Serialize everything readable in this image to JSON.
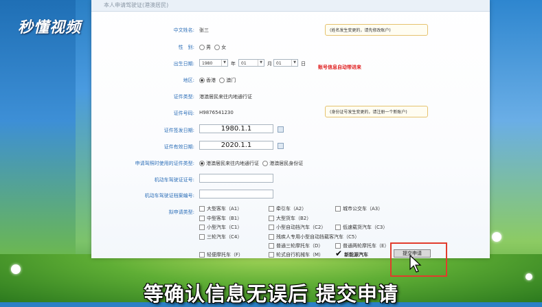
{
  "logo": "秒懂视频",
  "header": "本人申请驾驶证(港澳居民)",
  "form": {
    "name_label": "中文姓名:",
    "name_value": "张三",
    "name_note": "(姓名发生变更的，请先修改账户)",
    "gender_label": "性　别:",
    "gender_options": [
      "男",
      "女"
    ],
    "dob_label": "出生日期:",
    "dob_year": "1980",
    "dob_year_unit": "年",
    "dob_month": "01",
    "dob_month_unit": "月",
    "dob_day": "01",
    "dob_day_unit": "日",
    "auto_note": "账号信息自动带进来",
    "region_label": "地区:",
    "region_options": [
      "香港",
      "澳门"
    ],
    "idtype_label": "证件类型:",
    "idtype_value": "港澳居民来往内地通行证",
    "idnum_label": "证件号码:",
    "idnum_value": "H9876541230",
    "idnum_note": "(身份证号发生变更的，请注册一个新账户)",
    "issue_label": "证件签发日期:",
    "issue_value": "1980.1.1",
    "expiry_label": "证件有效日期:",
    "expiry_value": "2020.1.1",
    "apply_idtype_label": "申请驾照时使用的证件类型:",
    "apply_idtype_options": [
      "港澳居民来往内地通行证",
      "港澳居民身份证"
    ],
    "moto_license_label": "机动车驾驶证证号:",
    "moto_file_label": "机动车驾驶证档案编号:",
    "vehicle_label": "拟申请类型:",
    "vehicle_types": [
      [
        "大型客车（A1）",
        "牵引车（A2）",
        "城市公交车（A3）"
      ],
      [
        "中型客车（B1）",
        "大型货车（B2）",
        ""
      ],
      [
        "小型汽车（C1）",
        "小型自动挡汽车（C2）",
        "低速载货汽车（C3）"
      ],
      [
        "三轮汽车（C4）",
        "残疾人专用小型自动挡载客汽车（C5）",
        ""
      ],
      [
        "",
        "普通三轮摩托车（D）",
        "普通两轮摩托车（E）"
      ],
      [
        "轻便摩托车（F）",
        "轮式自行机械车（M）",
        "新能源汽车"
      ]
    ],
    "submit_label": "提交申请"
  },
  "caption": "等确认信息无误后 提交申请"
}
